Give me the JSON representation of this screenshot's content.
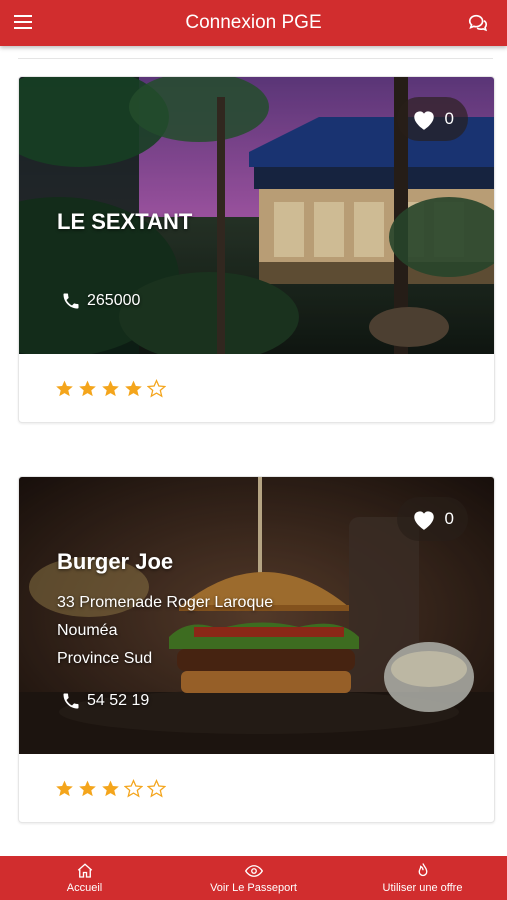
{
  "header": {
    "title": "Connexion PGE",
    "menu_icon": "menu-icon",
    "chat_icon": "chat-icon"
  },
  "restaurants": [
    {
      "name": "LE SEXTANT",
      "address_lines": [],
      "phone": "265000",
      "favorites": "0",
      "rating": 4,
      "max_rating": 5
    },
    {
      "name": "Burger Joe",
      "address_lines": [
        "33 Promenade Roger Laroque",
        "Nouméa",
        "Province Sud"
      ],
      "phone": "54 52 19",
      "favorites": "0",
      "rating": 3,
      "max_rating": 5
    }
  ],
  "bottom_nav": [
    {
      "label": "Accueil",
      "icon": "home-icon"
    },
    {
      "label": "Voir Le Passeport",
      "icon": "eye-icon"
    },
    {
      "label": "Utiliser une offre",
      "icon": "flame-icon"
    }
  ],
  "colors": {
    "primary": "#d12d2e",
    "star": "#f4a51c",
    "text_light": "#ffffff"
  }
}
